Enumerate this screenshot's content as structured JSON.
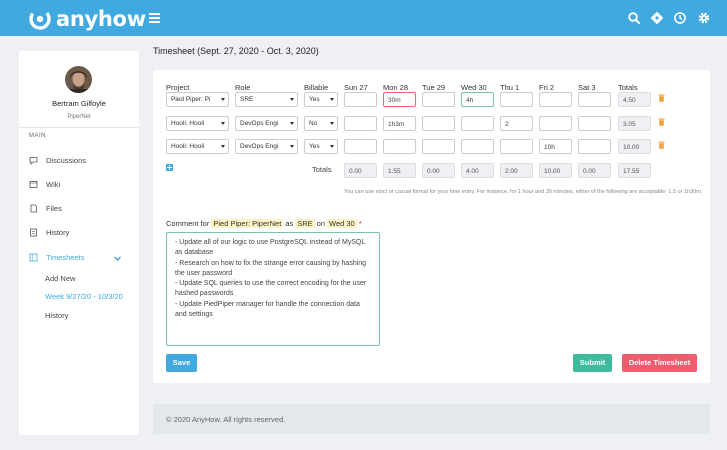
{
  "app": {
    "name": "anyhow"
  },
  "header": {
    "icons": [
      "search-icon",
      "compass-icon",
      "clock-icon",
      "gear-icon"
    ]
  },
  "user": {
    "name": "Bertram Gilfoyle",
    "org": "PiperNet"
  },
  "sidebar": {
    "section": "MAIN",
    "items": [
      {
        "label": "Discussions",
        "icon": "chat-icon"
      },
      {
        "label": "Wiki",
        "icon": "book-icon"
      },
      {
        "label": "Files",
        "icon": "file-icon"
      },
      {
        "label": "History",
        "icon": "history-icon"
      },
      {
        "label": "Timesheets",
        "icon": "timesheet-icon"
      }
    ],
    "subitems": [
      {
        "label": "Add New"
      },
      {
        "label": "Week 9/27/20 - 10/3/20"
      },
      {
        "label": "History"
      }
    ]
  },
  "page": {
    "title": "Timesheet (Sept. 27, 2020 - Oct. 3, 2020)"
  },
  "timesheet": {
    "headers": {
      "project": "Project",
      "role": "Role",
      "billable": "Billable",
      "days": [
        "Sun 27",
        "Mon 28",
        "Tue 29",
        "Wed 30",
        "Thu 1",
        "Fri 2",
        "Sat 3"
      ],
      "totals": "Totals"
    },
    "rows": [
      {
        "project": "Pied Piper: Pi",
        "role": "SRE",
        "billable": "Yes",
        "days": [
          "",
          "30m",
          "",
          "4h",
          "",
          "",
          ""
        ],
        "total": "4.50"
      },
      {
        "project": "Hooli: Hooli",
        "role": "DevOps Engi",
        "billable": "No",
        "days": [
          "",
          "1h3m",
          "",
          "",
          "2",
          "",
          ""
        ],
        "total": "3.05"
      },
      {
        "project": "Hooli: Hooli",
        "role": "DevOps Engi",
        "billable": "Yes",
        "days": [
          "",
          "",
          "",
          "",
          "",
          "10h",
          ""
        ],
        "total": "10.00"
      }
    ],
    "totals_label": "Totals",
    "column_totals": [
      "0.00",
      "1.55",
      "0.00",
      "4.00",
      "2.00",
      "10.00",
      "0.00",
      "17.55"
    ],
    "hint": "You can use strict or casual format for your time entry. For instance, for 1 hour and 30 minutes, either of the following are acceptable: 1.5 or 1h30m."
  },
  "comment": {
    "prefix": "Comment for",
    "project": "Pied Piper: PiperNet",
    "as": "as",
    "role": "SRE",
    "on": "on",
    "day": "Wed 30",
    "required": "*",
    "text": "- Update all of our logic to use PostgreSQL instead of MySQL as database\n- Research on how to fix the strange error causing by hashing the user password\n- Update SQL queries to use the correct encoding for the user hashed passwords\n- Update PiedPiper manager for handle the connection data and settings"
  },
  "buttons": {
    "save": "Save",
    "submit": "Submit",
    "delete": "Delete Timesheet"
  },
  "footer": {
    "text": "© 2020 AnyHow. All rights reserved."
  },
  "colors": {
    "primary": "#3fa9e0",
    "submit": "#3dbb9c",
    "delete": "#ee5c6f",
    "highlight": "#fcf4c4"
  }
}
